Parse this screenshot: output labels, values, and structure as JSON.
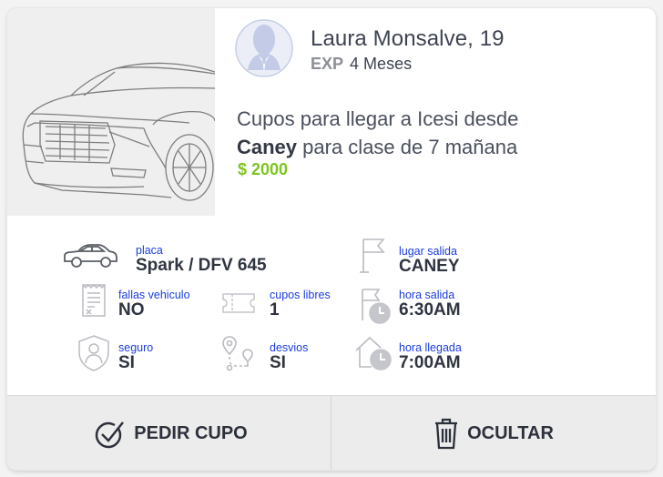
{
  "driver": {
    "name": "Laura Monsalve, 19",
    "exp_label": "EXP",
    "exp_value": "4 Meses"
  },
  "trip": {
    "line1": "Cupos para llegar a Icesi desde",
    "origin": "Caney",
    "line2_rest": " para clase de 7 mañana",
    "price": "$ 2000"
  },
  "details": {
    "placa": {
      "label": "placa",
      "value": "Spark / DFV 645",
      "icon": "car-icon"
    },
    "fallas": {
      "label": "fallas vehiculo",
      "value": "NO",
      "icon": "document-icon"
    },
    "seguro": {
      "label": "seguro",
      "value": "SI",
      "icon": "shield-person-icon"
    },
    "cupos": {
      "label": "cupos libres",
      "value": "1",
      "icon": "ticket-icon"
    },
    "desvios": {
      "label": "desvios",
      "value": "SI",
      "icon": "route-icon"
    },
    "lugar": {
      "label": "lugar salida",
      "value": "CANEY",
      "icon": "flag-icon"
    },
    "hora_salida": {
      "label": "hora salida",
      "value": "6:30AM",
      "icon": "calendar-clock-icon"
    },
    "hora_llegada": {
      "label": "hora llegada",
      "value": "7:00AM",
      "icon": "house-clock-icon"
    }
  },
  "actions": {
    "request_label": "PEDIR CUPO",
    "request_icon": "check-circle-icon",
    "hide_label": "OCULTAR",
    "hide_icon": "trash-icon"
  },
  "colors": {
    "label_blue": "#1a3de0",
    "price_green": "#7dc51f",
    "text_dark": "#2f3440"
  }
}
